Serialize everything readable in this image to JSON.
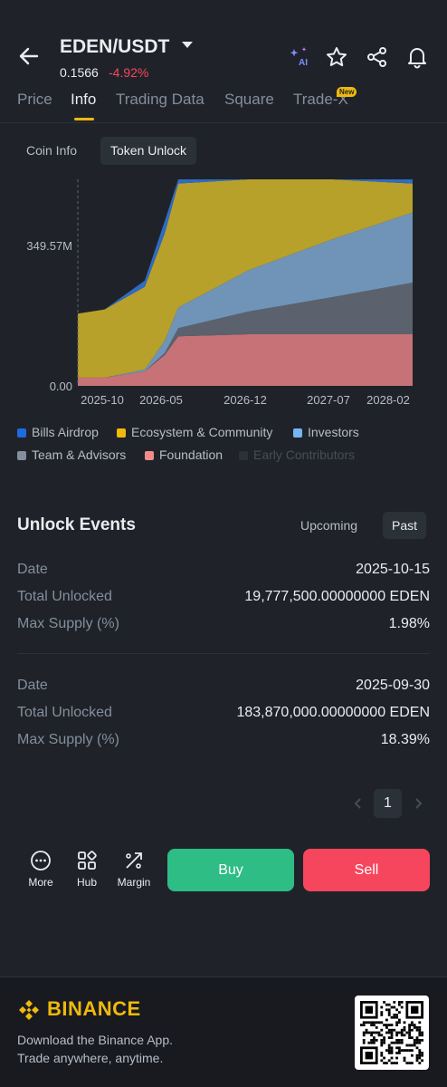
{
  "header": {
    "pair": "EDEN/USDT",
    "price": "0.1566",
    "change": "-4.92%",
    "icons": [
      "back-arrow-icon",
      "ai-sparkle-icon",
      "star-icon",
      "share-icon",
      "bell-icon"
    ]
  },
  "tabs": [
    {
      "label": "Price",
      "active": false
    },
    {
      "label": "Info",
      "active": true
    },
    {
      "label": "Trading Data",
      "active": false
    },
    {
      "label": "Square",
      "active": false
    },
    {
      "label": "Trade-X",
      "active": false,
      "badge": "New"
    }
  ],
  "subtabs": [
    {
      "label": "Coin Info",
      "active": false
    },
    {
      "label": "Token Unlock",
      "active": true
    }
  ],
  "chart": {
    "y_ticks": [
      "349.57M",
      "0.00"
    ],
    "x_ticks": [
      "2025-10",
      "2026-05",
      "2026-12",
      "2027-07",
      "2028-02"
    ]
  },
  "chart_data": {
    "type": "area",
    "stacked": true,
    "x": [
      "2025-09",
      "2025-10",
      "2026-01",
      "2026-05",
      "2026-06",
      "2026-12",
      "2027-07",
      "2028-02"
    ],
    "ylim": [
      0,
      500
    ],
    "y_unit": "M",
    "series": [
      {
        "name": "Foundation",
        "color": "#c77277",
        "values": [
          20,
          20,
          35,
          75,
          120,
          125,
          125,
          125
        ]
      },
      {
        "name": "Team & Advisors",
        "color": "#5b626d",
        "values": [
          0,
          0,
          0,
          5,
          20,
          55,
          90,
          125
        ]
      },
      {
        "name": "Investors",
        "color": "#6f94b8",
        "values": [
          0,
          0,
          5,
          30,
          50,
          100,
          140,
          170
        ]
      },
      {
        "name": "Ecosystem & Community",
        "color": "#b8a12a",
        "values": [
          155,
          165,
          200,
          260,
          300,
          240,
          160,
          70
        ]
      },
      {
        "name": "Bills Airdrop",
        "color": "#2f6bc4",
        "values": [
          0,
          0,
          15,
          30,
          30,
          30,
          30,
          30
        ]
      },
      {
        "name": "Early Contributors",
        "color": "#2b3139",
        "values": [
          0,
          0,
          0,
          0,
          0,
          0,
          0,
          0
        ]
      }
    ]
  },
  "legend": [
    {
      "label": "Bills Airdrop",
      "color": "#1e6ae0",
      "dim": false
    },
    {
      "label": "Ecosystem & Community",
      "color": "#f0b90b",
      "dim": false
    },
    {
      "label": "Investors",
      "color": "#77b5f2",
      "dim": false
    },
    {
      "label": "Team & Advisors",
      "color": "#848e9c",
      "dim": false
    },
    {
      "label": "Foundation",
      "color": "#f28b8e",
      "dim": false
    },
    {
      "label": "Early Contributors",
      "color": "#2b3139",
      "dim": true
    }
  ],
  "unlock": {
    "title": "Unlock Events",
    "toggle_upcoming": "Upcoming",
    "toggle_past": "Past",
    "events": [
      {
        "date_label": "Date",
        "date": "2025-10-15",
        "total_label": "Total Unlocked",
        "total": "19,777,500.00000000 EDEN",
        "supply_label": "Max Supply (%)",
        "supply": "1.98%"
      },
      {
        "date_label": "Date",
        "date": "2025-09-30",
        "total_label": "Total Unlocked",
        "total": "183,870,000.00000000 EDEN",
        "supply_label": "Max Supply (%)",
        "supply": "18.39%"
      }
    ],
    "page": "1"
  },
  "actions": {
    "more": "More",
    "hub": "Hub",
    "margin": "Margin",
    "buy": "Buy",
    "sell": "Sell"
  },
  "footer": {
    "brand": "BINANCE",
    "line1": "Download the Binance App.",
    "line2": "Trade anywhere, anytime."
  }
}
